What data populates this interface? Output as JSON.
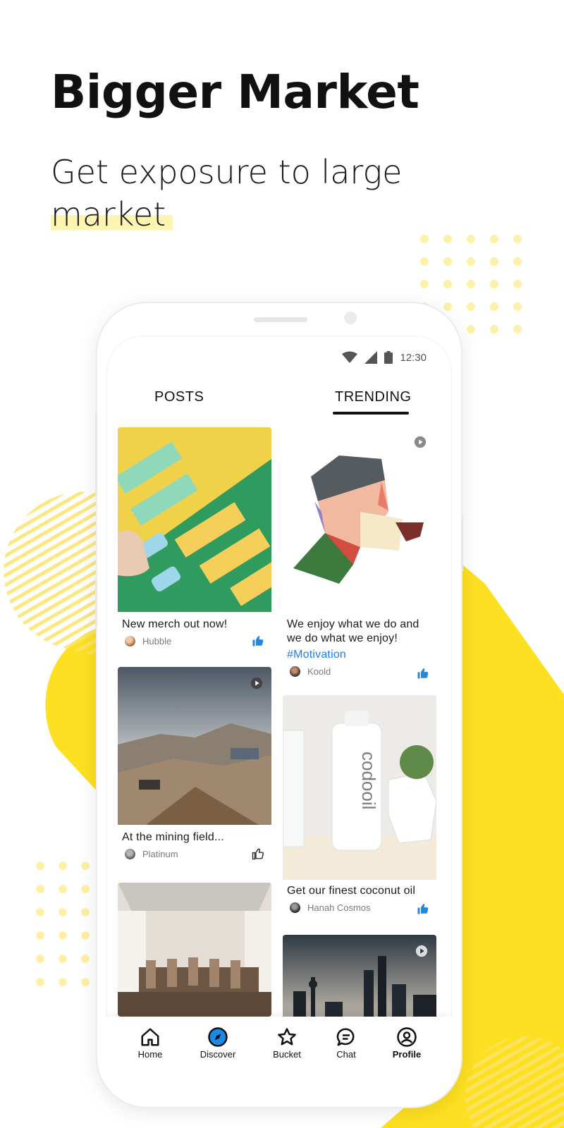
{
  "headline": "Bigger Market",
  "subline": {
    "line1": "Get exposure to large",
    "line2": "market"
  },
  "colors": {
    "accent_yellow": "#fde021",
    "highlight": "#fdf4b0",
    "link_blue": "#1f7ee6",
    "nav_active": "#1e88e5"
  },
  "status_bar": {
    "time": "12:30",
    "icons": [
      "wifi-icon",
      "signal-icon",
      "battery-icon"
    ]
  },
  "tabs": [
    {
      "label": "POSTS",
      "active": false
    },
    {
      "label": "TRENDING",
      "active": true
    }
  ],
  "posts": [
    {
      "title": "New merch out now!",
      "author": "Hubble",
      "liked": true,
      "media": "photo"
    },
    {
      "title": "At the mining field...",
      "author": "Platinum",
      "liked": false,
      "media": "video"
    },
    {
      "title": "",
      "author": "",
      "media": "photo"
    }
  ],
  "trending": [
    {
      "title": "We enjoy what we do and we do what we enjoy!",
      "hashtag": "#Motivation",
      "author": "Koold",
      "liked": true,
      "media": "video"
    },
    {
      "title": "Get our finest coconut oil",
      "author": "Hanah Cosmos",
      "liked": true,
      "media": "photo"
    },
    {
      "title": "",
      "author": "",
      "media": "video"
    }
  ],
  "nav": [
    {
      "label": "Home",
      "icon": "home-icon",
      "active": false
    },
    {
      "label": "Discover",
      "icon": "compass-icon",
      "active": true
    },
    {
      "label": "Bucket",
      "icon": "star-icon",
      "active": false
    },
    {
      "label": "Chat",
      "icon": "chat-icon",
      "active": false
    },
    {
      "label": "Profile",
      "icon": "profile-icon",
      "active": false
    }
  ]
}
